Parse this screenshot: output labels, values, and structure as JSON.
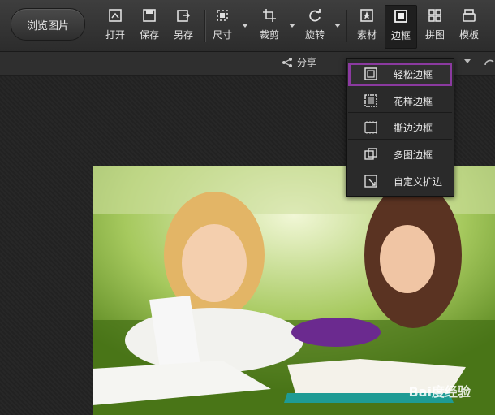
{
  "toolbar": {
    "browse_label": "浏览图片",
    "tools": [
      {
        "label": "打开",
        "icon": "open-icon"
      },
      {
        "label": "保存",
        "icon": "save-icon"
      },
      {
        "label": "另存",
        "icon": "save-as-icon"
      },
      {
        "label": "尺寸",
        "icon": "resize-icon"
      },
      {
        "label": "裁剪",
        "icon": "crop-icon"
      },
      {
        "label": "旋转",
        "icon": "rotate-icon"
      },
      {
        "label": "素材",
        "icon": "material-icon"
      },
      {
        "label": "边框",
        "icon": "frame-icon",
        "active": true
      },
      {
        "label": "拼图",
        "icon": "collage-icon"
      },
      {
        "label": "模板",
        "icon": "template-icon"
      }
    ]
  },
  "subbar": {
    "share_label": "分享"
  },
  "frame_menu": {
    "items": [
      {
        "label": "轻松边框",
        "icon": "simple-frame-icon",
        "highlighted": true
      },
      {
        "label": "花样边框",
        "icon": "pattern-frame-icon"
      },
      {
        "label": "撕边边框",
        "icon": "torn-edge-frame-icon"
      },
      {
        "label": "多图边框",
        "icon": "multi-image-frame-icon"
      },
      {
        "label": "自定义扩边",
        "icon": "custom-expand-icon"
      }
    ]
  },
  "watermark": "Bai度经验"
}
